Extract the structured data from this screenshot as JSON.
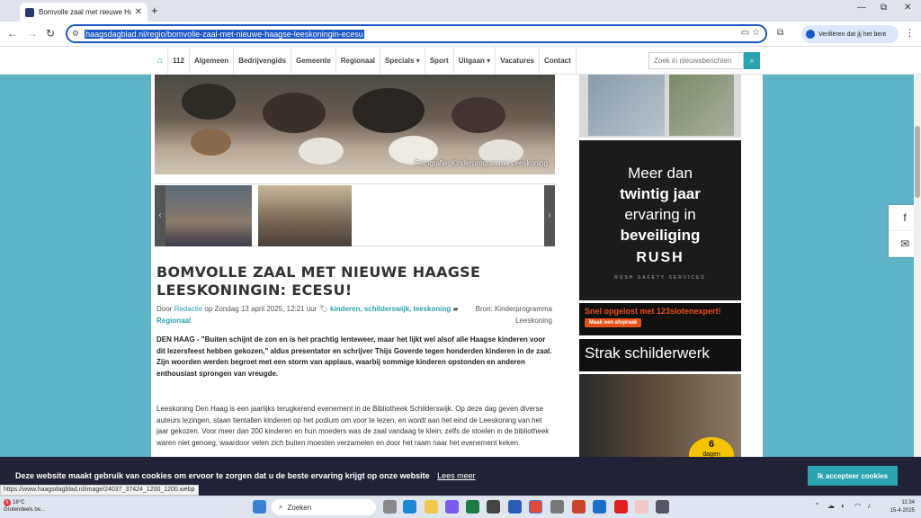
{
  "browser": {
    "tab_title": "Bomvolle zaal met nieuwe Haagse",
    "tab_close": "✕",
    "new_tab": "+",
    "url": "haagsdagblad.nl/regio/bomvolle-zaal-met-nieuwe-haagse-leeskoningin-ecesu",
    "verify_label": "Verifiëren dat jij het bent",
    "window_controls": [
      "—",
      "⧉",
      "✕"
    ]
  },
  "nav": {
    "items": [
      "112",
      "Algemeen",
      "Bedrijvengids",
      "Gemeente",
      "Regionaal",
      "Specials ▾",
      "Sport",
      "Uitgaan ▾",
      "Vacatures",
      "Contact"
    ],
    "search_placeholder": "Zoek in nieuwsberichten"
  },
  "article": {
    "photo_caption": "Fotografie: Kinderprogramma Leeskoning",
    "title": "BOMVOLLE ZAAL MET NIEUWE HAAGSE LEESKONINGIN: ECESU!",
    "meta_prefix": "Door",
    "author": "Redactie",
    "date": "op Zondag 13 april 2025, 12:21 uur",
    "tags": "kinderen, schilderswijk, leeskoning",
    "category": "Regionaal",
    "source": "Bron: Kinderprogramma Leeskoning",
    "lead": "DEN HAAG - \"Buiten schijnt de zon en is het prachtig lenteweer, maar het lijkt wel alsof alle Haagse kinderen voor dit lezersfeest hebben gekozen,\" aldus presentator en schrijver Thijs Goverde tegen honderden kinderen in de zaal. Zijn woorden werden begroet met een storm van applaus, waarbij sommige kinderen opstonden en anderen enthousiast sprongen van vreugde.",
    "body": "Leeskoning Den Haag is een jaarlijks terugkerend evenement in de Bibliotheek Schilderswijk. Op deze dag geven diverse auteurs lezingen, staan tientallen kinderen op het podium om voor te lezen, en wordt aan het eind de Leeskoning van het jaar gekozen. Voor meer dan 200 kinderen en hun moeders was de zaal vandaag te klein; zelfs de stoelen in de bibliotheek waren niet genoeg, waardoor velen zich buiten moesten verzamelen en door het raam naar het evenement keken."
  },
  "ads": {
    "rush_line1": "Meer dan",
    "rush_line2": "twintig jaar",
    "rush_line3": "ervaring in",
    "rush_line4": "beveiliging",
    "rush_logo": "RUSH",
    "rush_sub": "RUSH SAFETY SERVICES",
    "slot_text": "Snel opgelost met 123slotenexpert!",
    "slot_btn": "Maak een afspraak",
    "schilder": "Strak schilderwerk",
    "badge_num": "6",
    "badge_text": "dagen"
  },
  "cookie": {
    "text": "Deze website maakt gebruik van cookies om ervoor te zorgen dat u de beste ervaring krijgt op onze website",
    "learn_more": "Lees meer",
    "accept": "Ik accepteer cookies"
  },
  "status_url": "https://www.haagsdagblad.nl/image/24037_37424_1200_1200.webp",
  "taskbar": {
    "weather_badge": "6",
    "temp": "18°C",
    "weather_desc": "Grotendeels be...",
    "search": "Zoeken",
    "time": "11:34",
    "date": "15-4-2025"
  },
  "colors": {
    "accent": "#2aa3b3",
    "background": "#5eb4c6",
    "cookie_bar": "#222236"
  }
}
